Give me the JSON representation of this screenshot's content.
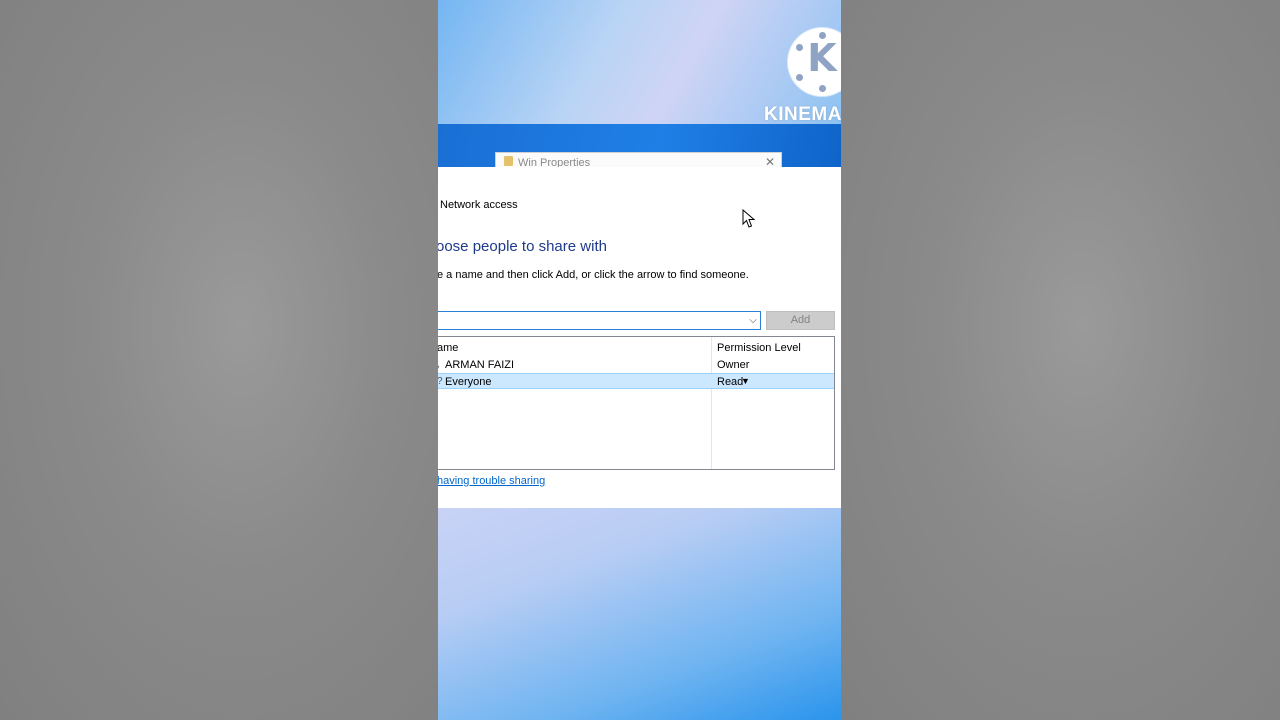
{
  "logo": {
    "letter": "K",
    "text": "KINEMAS"
  },
  "properties_window": {
    "title": "Win Properties",
    "close_glyph": "✕"
  },
  "dialog": {
    "title": "Network access",
    "heading": "oose people to share with",
    "instruction": "e a name and then click Add, or click the arrow to find someone.",
    "name_input": {
      "value": "",
      "placeholder": ""
    },
    "dropdown_glyph": "⌵",
    "add_button_label": "Add",
    "table": {
      "columns": [
        "ame",
        "Permission Level"
      ],
      "rows": [
        {
          "icon": "user-icon",
          "icon_glyph": ",",
          "name": "ARMAN FAIZI",
          "permission": "Owner",
          "selected": false
        },
        {
          "icon": "group-icon",
          "icon_glyph": "?",
          "name": "Everyone",
          "permission": "Read",
          "selected": true,
          "arrow_glyph": "▼"
        }
      ]
    },
    "help_link": " having trouble sharing"
  },
  "colors": {
    "heading": "#1e3a8a",
    "link": "#0066cc",
    "selection": "#cce8ff",
    "input_border": "#2a7fd6"
  }
}
